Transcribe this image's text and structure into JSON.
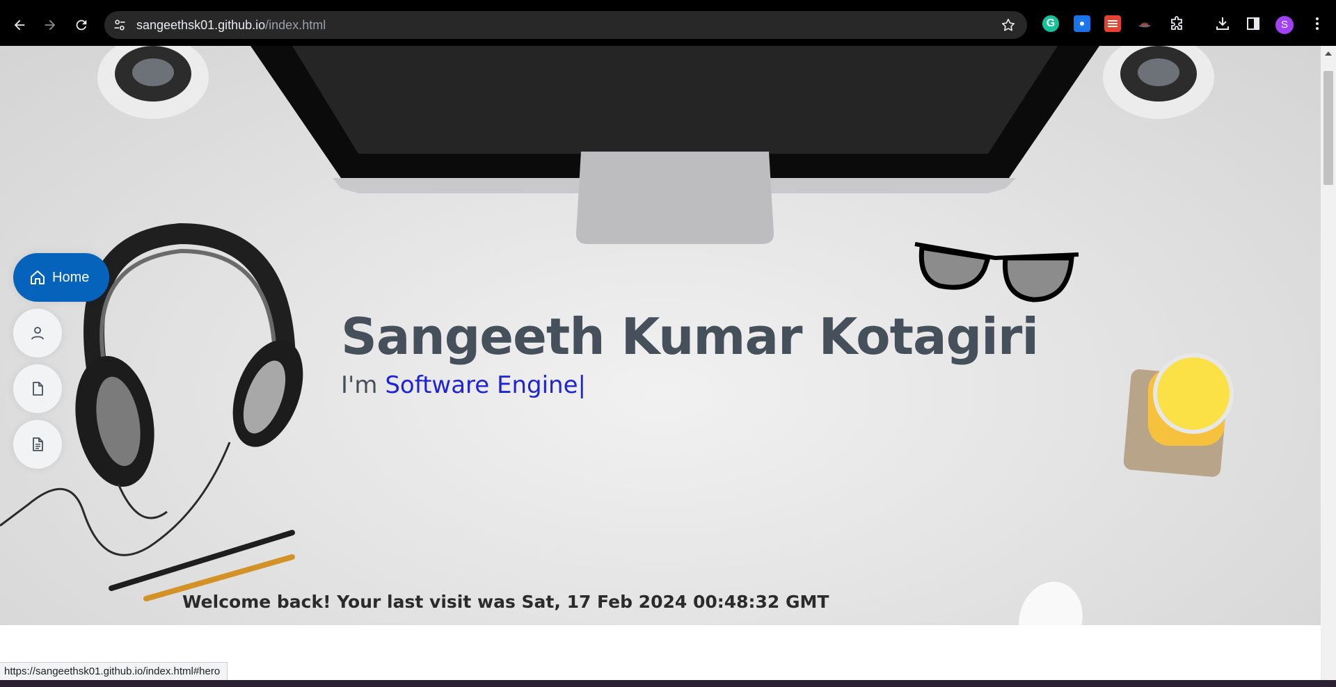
{
  "browser": {
    "url_host": "sangeethsk01.github.io",
    "url_path": "/index.html",
    "profile_initial": "S",
    "status_url": "https://sangeethsk01.github.io/index.html#hero",
    "extensions": [
      "grammarly-icon",
      "screen-capture-icon",
      "todoist-icon",
      "hat-icon",
      "extensions-puzzle-icon"
    ]
  },
  "hero": {
    "name": "Sangeeth Kumar Kotagiri",
    "prefix": "I'm ",
    "typed_text": "Software Engine",
    "cursor": "|",
    "welcome": "Welcome back! Your last visit was Sat, 17 Feb 2024 00:48:32 GMT"
  },
  "nav": {
    "items": [
      {
        "label": "Home",
        "icon": "house-icon",
        "active": true
      },
      {
        "label": "",
        "icon": "person-icon",
        "active": false
      },
      {
        "label": "",
        "icon": "file-icon",
        "active": false
      },
      {
        "label": "",
        "icon": "file-text-icon",
        "active": false
      }
    ]
  },
  "colors": {
    "accent": "#0563bb",
    "name_text": "#45505b",
    "typed_text": "#1e24d6"
  }
}
